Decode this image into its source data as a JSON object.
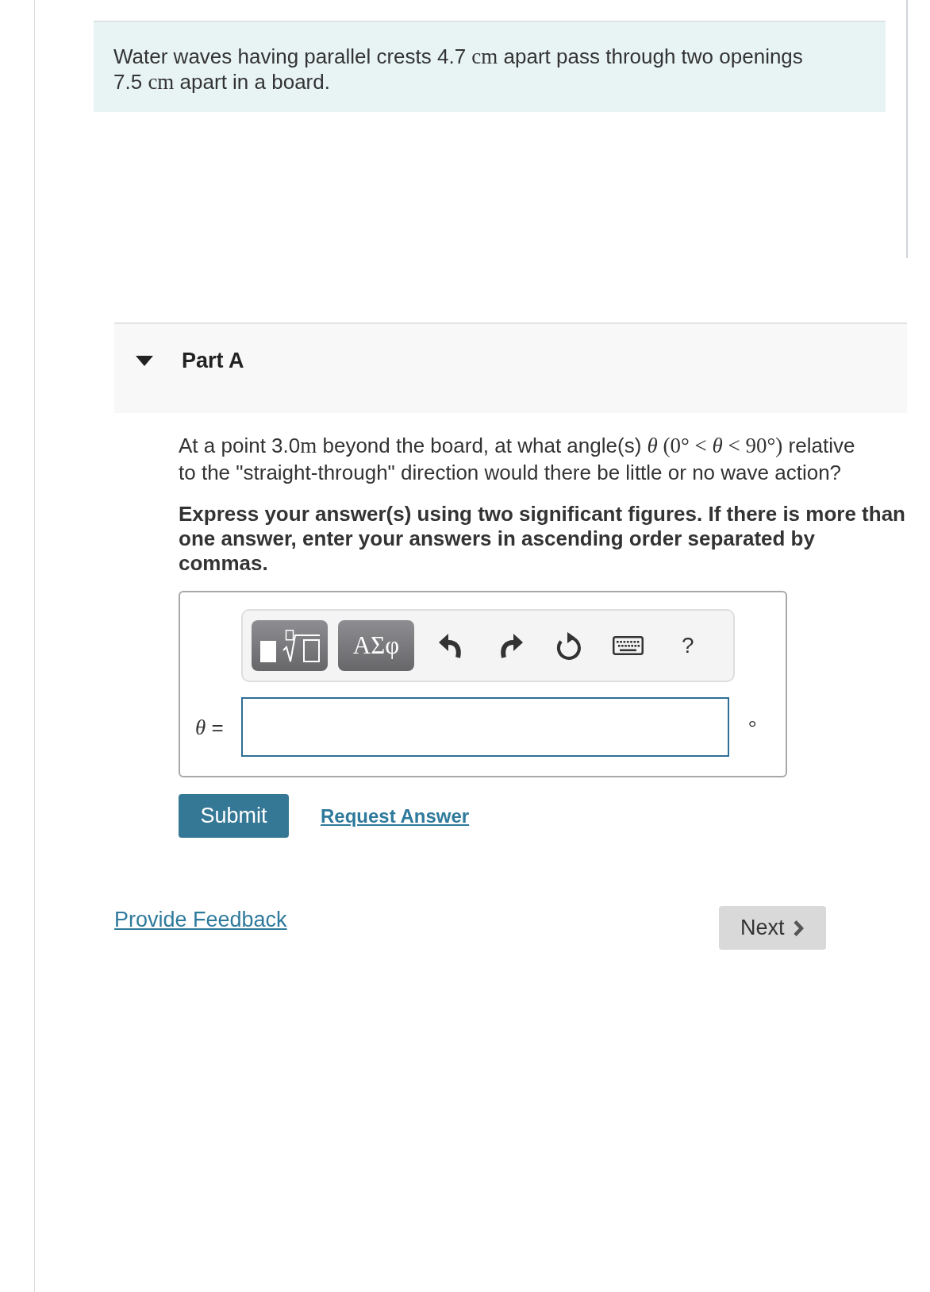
{
  "problem": {
    "segments": [
      {
        "kind": "text",
        "text": "Water waves having parallel crests 4.7 "
      },
      {
        "kind": "math",
        "text": "cm"
      },
      {
        "kind": "text",
        "text": " apart pass through two openings 7.5 "
      },
      {
        "kind": "math",
        "text": "cm"
      },
      {
        "kind": "text",
        "text": " apart in a board."
      }
    ]
  },
  "part": {
    "title": "Part A",
    "expanded": true,
    "question": {
      "segments": [
        {
          "kind": "text",
          "text": "At a point 3.0"
        },
        {
          "kind": "math",
          "text": "m"
        },
        {
          "kind": "text",
          "text": " beyond the board, at what angle(s) "
        },
        {
          "kind": "math",
          "text": "*θ* (0° < *θ* < 90°)"
        },
        {
          "kind": "text",
          "text": " relative to the \"straight-through\" direction would there be little or no wave action?"
        }
      ]
    },
    "instructions": "Express your answer(s) using two significant figures. If there is more than one answer, enter your answers in ascending order separated by commas.",
    "answer": {
      "toolbar": [
        {
          "kind": "templates"
        },
        {
          "kind": "symbols",
          "label": "ΑΣφ"
        },
        {
          "kind": "undo"
        },
        {
          "kind": "redo"
        },
        {
          "kind": "reset"
        },
        {
          "kind": "keyboard"
        },
        {
          "kind": "help",
          "label": "?"
        }
      ],
      "variable": [
        {
          "kind": "math",
          "text": "*θ*"
        },
        {
          "kind": "text",
          "text": " ="
        }
      ],
      "unit": "°"
    },
    "submit_button": "Submit",
    "request_answer_link": "Request Answer"
  },
  "footer": {
    "feedback_link": "Provide Feedback",
    "next_button": "Next"
  }
}
